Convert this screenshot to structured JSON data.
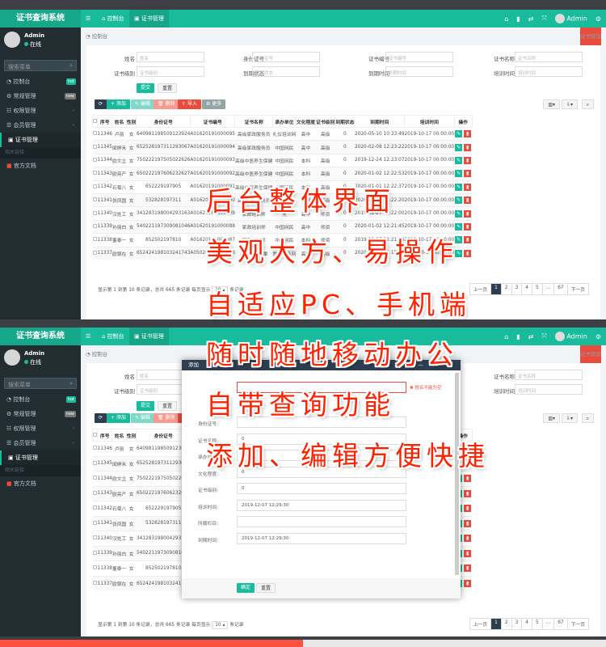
{
  "app": {
    "title": "证书查询系统",
    "header_tabs": [
      "控制台",
      "证书管理"
    ],
    "user": "Admin"
  },
  "sidebar": {
    "user_name": "Admin",
    "status": "在线",
    "search_placeholder": "搜索菜单",
    "items": [
      {
        "label": "控制台",
        "badge": "hot",
        "badge_color": "#18bc9c"
      },
      {
        "label": "常规管理",
        "badge": "new",
        "badge_color": "#777"
      },
      {
        "label": "权限管理",
        "badge": "‹"
      },
      {
        "label": "会员管理",
        "badge": "‹"
      },
      {
        "label": "证书管理",
        "badge": ""
      }
    ],
    "section": "相关链接",
    "doc": "官方文档"
  },
  "breadcrumb": {
    "home": "控制台",
    "right": "证书管理"
  },
  "filters": [
    {
      "label": "姓名",
      "placeholder": "姓名"
    },
    {
      "label": "身份证号",
      "placeholder": "身份证号"
    },
    {
      "label": "证书编号",
      "placeholder": "证书编号"
    },
    {
      "label": "证书名称",
      "placeholder": "证书名称"
    },
    {
      "label": "证书级别",
      "placeholder": "证书级别"
    },
    {
      "label": "到期状态",
      "placeholder": "到期状态"
    },
    {
      "label": "到期时间",
      "placeholder": "到期时间"
    },
    {
      "label": "培训时间",
      "placeholder": "培训时间"
    }
  ],
  "filter_buttons": {
    "submit": "提交",
    "reset": "重置"
  },
  "toolbar": {
    "refresh": "⟳",
    "add": "+ 添加",
    "edit": "✎ 编辑",
    "delete": "🗑 删除",
    "import": "⇪ 导入",
    "more": "⚙ 更多"
  },
  "table": {
    "headers": [
      "序号",
      "姓名",
      "性别",
      "身份证号",
      "证书编号",
      "证书名称",
      "承办单位",
      "文化程度",
      "证书级别",
      "到期状态",
      "到期时间",
      "培训时间",
      "操作"
    ],
    "rows": [
      [
        "11346",
        "卢丽",
        "女",
        "640981198509123924",
        "A01620191000095",
        "高级家政服务员",
        "礼仪培训网",
        "高中",
        "高级",
        "0",
        "2020-05-10 10:33:49",
        "2019-10-17 00:00:00"
      ],
      [
        "11345",
        "闻婷禾",
        "女",
        "652528197311293067",
        "A01620191000094",
        "高级家政服务员",
        "中国网民",
        "高中",
        "高级",
        "0",
        "2020-02-08 12:23:22",
        "2019-10-17 00:00:00"
      ],
      [
        "11344",
        "欧文立",
        "女",
        "750222197505022626",
        "A01620191000093",
        "高级中医养生保健",
        "中国网民",
        "本科",
        "高级",
        "0",
        "2019-12-24 12:23:07",
        "2019-10-17 00:00:00"
      ],
      [
        "11343",
        "欧亮产",
        "女",
        "650222197606232627",
        "A01620191000092",
        "高级中医养生保健",
        "中国网民",
        "本科",
        "高级",
        "0",
        "2020-01-02 12:22:53",
        "2019-10-17 00:00:00"
      ],
      [
        "11342",
        "石菊八",
        "女",
        "652229197905",
        "A01620191000091",
        "高级中医养生保健",
        "中国网民",
        "本科",
        "高级",
        "0",
        "2020-01-01 12:22:37",
        "2019-10-17 00:00:00"
      ],
      [
        "11341",
        "张凤国",
        "女",
        "532828197311",
        "A01620191000090",
        "高级家政服务员",
        "中国网民",
        "本科",
        "高级",
        "0",
        "2020-01-05 12:22:20",
        "2019-10-17 00:00:00"
      ],
      [
        "11340",
        "汉姓工",
        "女",
        "341283198004293163",
        "A01620191000089",
        "家政培训师",
        "无",
        "高中",
        "师资",
        "0",
        "2019-12-27 12:22:00",
        "2019-10-17 00:00:00"
      ],
      [
        "11339",
        "孙丽白",
        "女",
        "540221197309081046",
        "A01620191000088",
        "家政培训师",
        "中国网民",
        "高中",
        "师资",
        "0",
        "2020-01-02 12:21:45",
        "2019-10-17 00:00:00"
      ],
      [
        "11338",
        "董泰一",
        "女",
        "852502197810",
        "A01620191000087",
        "家政培训师",
        "中国网民",
        "本科",
        "师资",
        "0",
        "2019-12-27 12:21:26",
        "2019-10-17 00:00:00"
      ],
      [
        "11337",
        "欧银在",
        "女",
        "652424198103241743",
        "A05020191003718",
        "高级小儿推拿",
        "教育服务网",
        "高中",
        "高级",
        "0",
        "2020-01-02 10:15:14",
        "2019-10-17 00:00:00"
      ]
    ]
  },
  "pagination": {
    "summary": "显示第 1 到第 10 条记录，总共 665 条记录 每页显示",
    "page_size": "10 ▴",
    "suffix": "条记录",
    "pages": [
      "上一页",
      "1",
      "2",
      "3",
      "4",
      "5",
      "...",
      "67",
      "下一页"
    ]
  },
  "modal": {
    "title": "添加",
    "error": "✖ 姓名不能为空",
    "controls": "— ❐ ✕",
    "fields": [
      {
        "label": "身份证号:",
        "value": ""
      },
      {
        "label": "证书名称:",
        "value": "0"
      },
      {
        "label": "承办单位:",
        "value": "0"
      },
      {
        "label": "文化程度:",
        "value": "0"
      },
      {
        "label": "证书级别:",
        "value": "0"
      },
      {
        "label": "培训时间:",
        "value": "2019-12-07 12:29:30"
      },
      {
        "label": "所属栏目:",
        "value": ""
      },
      {
        "label": "到期时间:",
        "value": "2019-12-07 12:29:30"
      }
    ],
    "ok": "确定",
    "reset": "重置"
  },
  "overlay": [
    "后台整体界面",
    "美观大方、易操作",
    "自适应PC、手机端",
    "随时随地移动办公",
    "自带查询功能",
    "添加、编辑方便快捷"
  ],
  "colors": {
    "accent": "#18bc9c",
    "sidebar": "#222d32",
    "danger": "#e74c3c",
    "overlay": "#ff2200"
  }
}
